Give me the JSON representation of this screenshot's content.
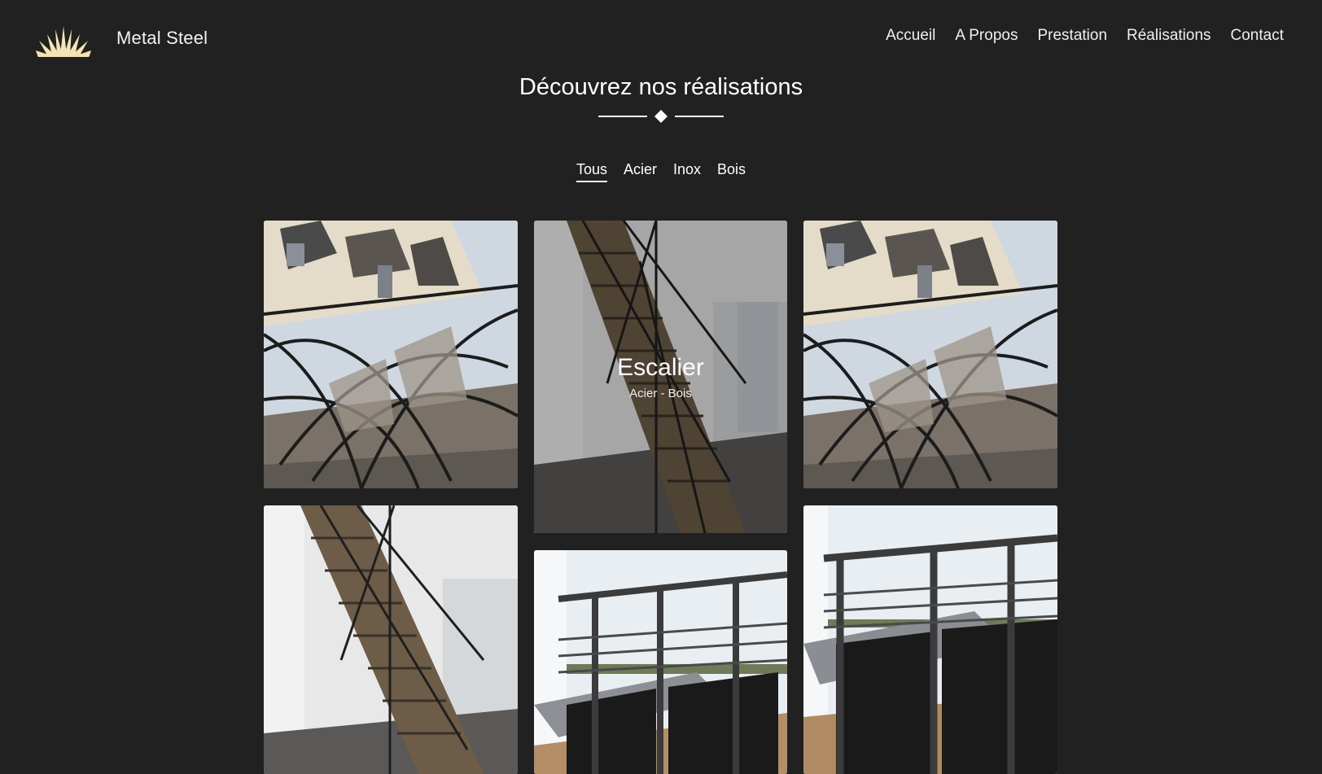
{
  "brand": {
    "name": "Metal Steel",
    "logo_icon": "crown-sunburst-icon",
    "logo_color": "#f3e3b6"
  },
  "nav": {
    "items": [
      {
        "label": "Accueil"
      },
      {
        "label": "A Propos"
      },
      {
        "label": "Prestation"
      },
      {
        "label": "Réalisations"
      },
      {
        "label": "Contact"
      }
    ]
  },
  "section": {
    "title": "Découvrez nos réalisations"
  },
  "filters": {
    "items": [
      {
        "label": "Tous",
        "active": true
      },
      {
        "label": "Acier"
      },
      {
        "label": "Inox"
      },
      {
        "label": "Bois"
      }
    ]
  },
  "gallery": {
    "items": [
      {
        "photo": "railing-sunburst"
      },
      {
        "photo": "staircase",
        "hover": {
          "title": "Escalier",
          "subtitle": "Acier - Bois"
        }
      },
      {
        "photo": "railing-sunburst"
      },
      {
        "photo": "staircase"
      },
      {
        "photo": "balcony-railing"
      },
      {
        "photo": "balcony-railing"
      }
    ]
  },
  "colors": {
    "background": "#212121",
    "text": "#ffffff"
  }
}
